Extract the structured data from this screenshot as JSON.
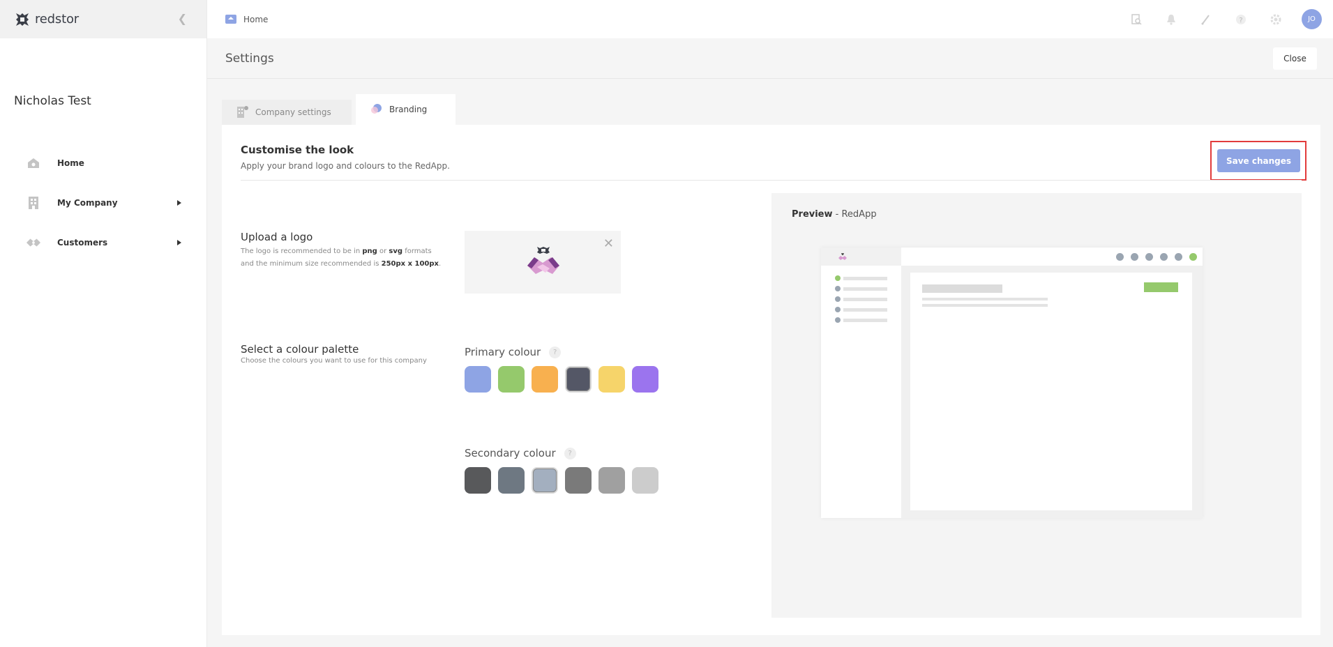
{
  "app": {
    "brand": "redstor",
    "company_name": "Nicholas Test",
    "user_initials": "JO"
  },
  "sidebar": {
    "items": [
      {
        "label": "Home",
        "icon": "home-icon",
        "has_submenu": false
      },
      {
        "label": "My Company",
        "icon": "building-icon",
        "has_submenu": true
      },
      {
        "label": "Customers",
        "icon": "handshake-icon",
        "has_submenu": true
      }
    ]
  },
  "topbar": {
    "breadcrumb": "Home",
    "icons": [
      "search-icon",
      "bell-icon",
      "stats-icon",
      "help-icon",
      "gear-icon"
    ]
  },
  "settings": {
    "title": "Settings",
    "close_label": "Close",
    "tabs": [
      {
        "label": "Company settings",
        "active": false
      },
      {
        "label": "Branding",
        "active": true
      }
    ]
  },
  "branding": {
    "title": "Customise the look",
    "subtitle": "Apply your brand logo and colours to the RedApp.",
    "save_label": "Save changes",
    "upload": {
      "title": "Upload a logo",
      "desc_prefix": "The logo is recommended to be in ",
      "format1": "png",
      "desc_or": " or ",
      "format2": "svg",
      "desc_mid": " formats and the minimum size recommended is ",
      "size": "250px x 100px",
      "desc_end": "."
    },
    "palette": {
      "title": "Select a colour palette",
      "subtitle": "Choose the colours you want to use for this company",
      "primary_label": "Primary colour",
      "secondary_label": "Secondary colour",
      "primary": [
        "#8ea4e4",
        "#95c96c",
        "#f8b04f",
        "#545766",
        "#f6d46a",
        "#9b74ee"
      ],
      "primary_selected": 3,
      "secondary": [
        "#58595b",
        "#6e7882",
        "#a3afbf",
        "#7a7a7a",
        "#a0a0a0",
        "#cccccc"
      ],
      "secondary_selected": 2
    },
    "preview": {
      "label": "Preview",
      "app_name": "RedApp",
      "accent": "#95c96c",
      "secondary": "#9aa5b1"
    }
  }
}
